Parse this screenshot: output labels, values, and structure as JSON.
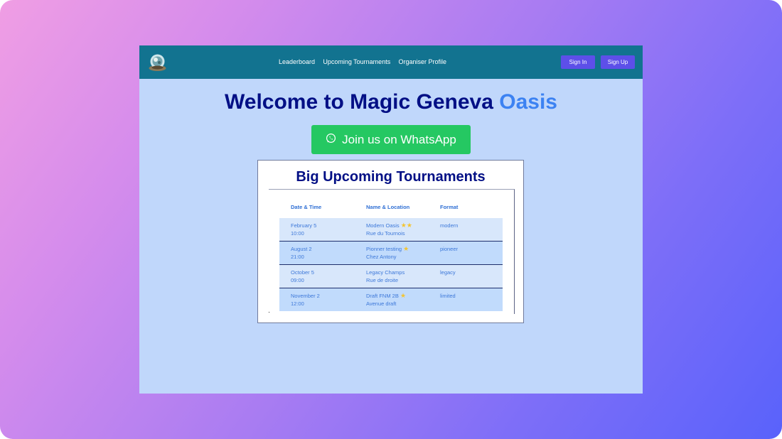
{
  "navbar": {
    "links": [
      "Leaderboard",
      "Upcoming Tournaments",
      "Organiser Profile"
    ],
    "sign_in": "Sign In",
    "sign_up": "Sign Up",
    "logo_icon": "crystal-ball-logo-icon"
  },
  "hero": {
    "title_main": "Welcome to Magic Geneva",
    "title_accent": "Oasis",
    "whatsapp_label": "Join us on WhatsApp",
    "whatsapp_icon": "whatsapp-icon"
  },
  "tournaments": {
    "heading": "Big Upcoming Tournaments",
    "columns": [
      "Date & Time",
      "Name & Location",
      "Format"
    ],
    "rows": [
      {
        "date": "February 5",
        "time": "10:00",
        "name": "Modern Oasis",
        "location": "Rue du Tournois",
        "stars": "★★",
        "format": "modern"
      },
      {
        "date": "August 2",
        "time": "21:00",
        "name": "Pionner testing",
        "location": "Chez Antony",
        "stars": "★",
        "format": "pioneer"
      },
      {
        "date": "October 5",
        "time": "09:00",
        "name": "Legacy Champs",
        "location": "Rue de droite",
        "stars": "",
        "format": "legacy"
      },
      {
        "date": "November 2",
        "time": "12:00",
        "name": "Draft FNM 2B",
        "location": "Avenue draft",
        "stars": "★",
        "format": "limited"
      }
    ]
  },
  "colors": {
    "navbar": "#127390",
    "page_background": "#c0d7fb",
    "title": "#020f85",
    "accent": "#3c82f2",
    "whatsapp": "#25c862",
    "button": "#5d4fe9"
  }
}
